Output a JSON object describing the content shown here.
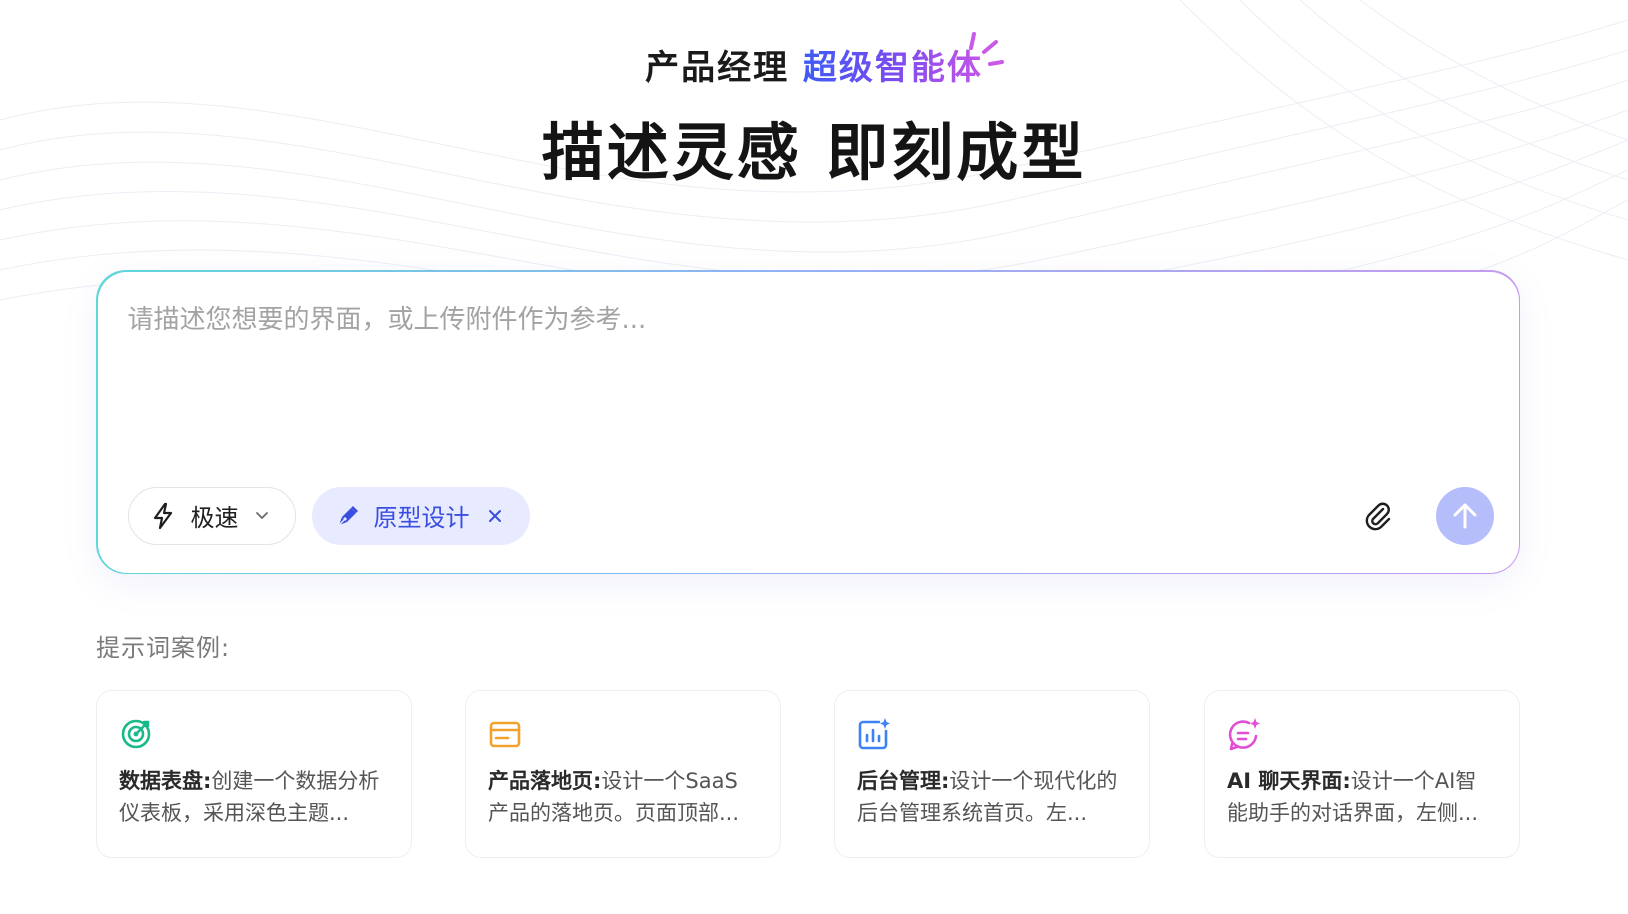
{
  "header": {
    "subtitle_plain": "产品经理",
    "subtitle_highlight": "超级智能体",
    "title": "描述灵感 即刻成型"
  },
  "composer": {
    "placeholder": "请描述您想要的界面，或上传附件作为参考...",
    "value": "",
    "speed_select": {
      "icon": "lightning-icon",
      "selected": "极速"
    },
    "mode_chip": {
      "icon": "pen-icon",
      "label": "原型设计"
    },
    "attach_icon": "paperclip-icon",
    "send_icon": "arrow-up-icon",
    "send_color": "#b5befa"
  },
  "examples": {
    "label": "提示词案例:",
    "items": [
      {
        "icon": "dashboard-gauge-icon",
        "icon_color": "#19b98a",
        "title": "数据表盘:",
        "body": "创建一个数据分析仪表板，采用深色主题..."
      },
      {
        "icon": "browser-window-icon",
        "icon_color": "#f2a12a",
        "title": "产品落地页:",
        "body": "设计一个SaaS产品的落地页。页面顶部..."
      },
      {
        "icon": "bar-chart-sparkle-icon",
        "icon_color": "#3d82f2",
        "title": "后台管理:",
        "body": "设计一个现代化的后台管理系统首页。左..."
      },
      {
        "icon": "chat-bubble-sparkle-icon",
        "icon_color": "#e24fd4",
        "title": "AI 聊天界面:",
        "body": "设计一个AI智能助手的对话界面，左侧..."
      }
    ]
  }
}
